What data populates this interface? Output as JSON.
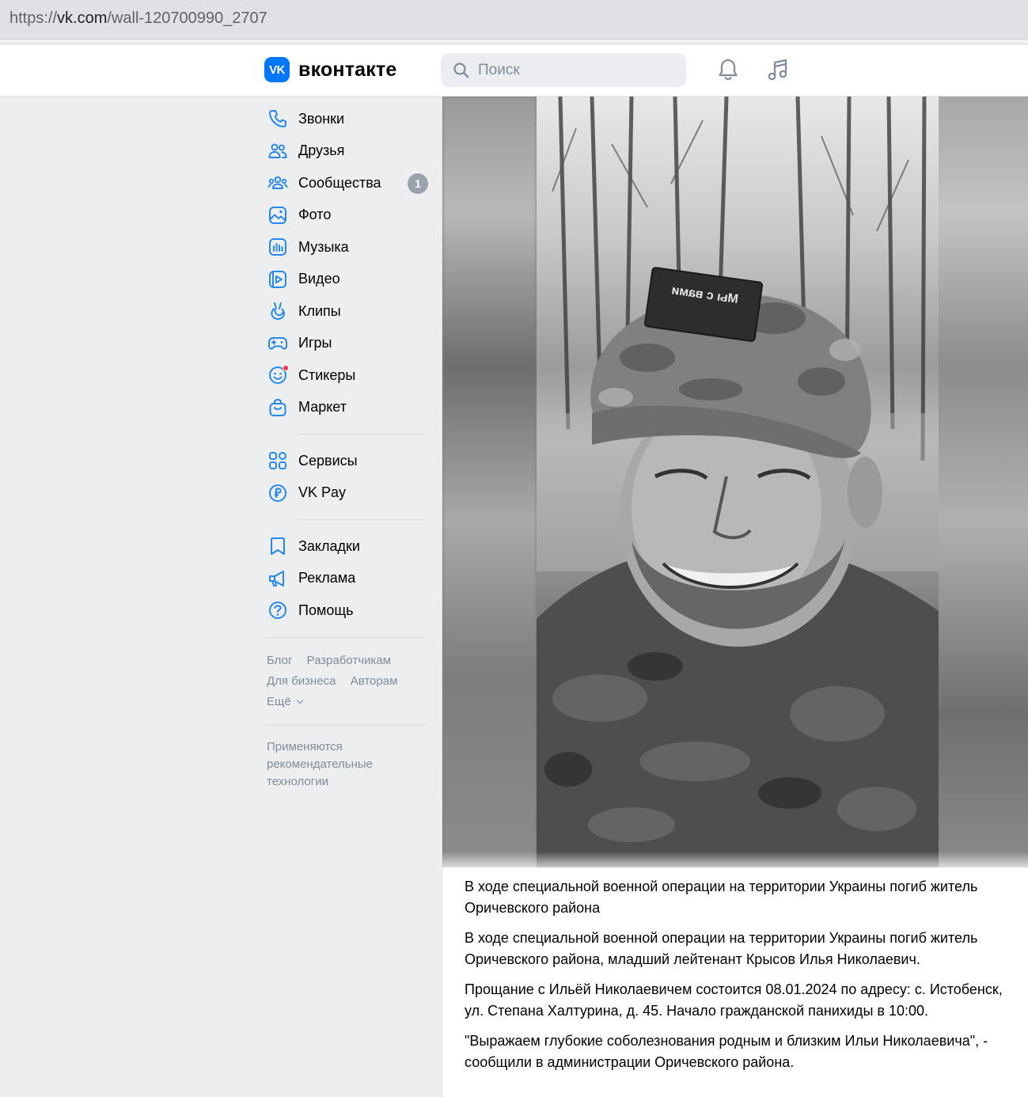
{
  "browser": {
    "url_prefix": "https://",
    "url_domain": "vk.com",
    "url_path": "/wall-120700990_2707"
  },
  "header": {
    "logo_badge": "VK",
    "logo_text": "вконтакте",
    "search_placeholder": "Поиск",
    "icons": [
      "bell-icon",
      "music-note-icon"
    ]
  },
  "sidebar": {
    "items": [
      {
        "label": "Звонки",
        "icon": "phone-icon"
      },
      {
        "label": "Друзья",
        "icon": "friends-icon"
      },
      {
        "label": "Сообщества",
        "icon": "communities-icon",
        "count": "1"
      },
      {
        "label": "Фото",
        "icon": "photo-icon"
      },
      {
        "label": "Музыка",
        "icon": "music-icon"
      },
      {
        "label": "Видео",
        "icon": "video-icon"
      },
      {
        "label": "Клипы",
        "icon": "clips-icon"
      },
      {
        "label": "Игры",
        "icon": "gamepad-icon"
      },
      {
        "label": "Стикеры",
        "icon": "smile-icon"
      },
      {
        "label": "Маркет",
        "icon": "market-bag-icon"
      }
    ],
    "items2": [
      {
        "label": "Сервисы",
        "icon": "services-grid-icon"
      },
      {
        "label": "VK Pay",
        "icon": "ruble-icon"
      }
    ],
    "items3": [
      {
        "label": "Закладки",
        "icon": "bookmark-icon"
      },
      {
        "label": "Реклама",
        "icon": "megaphone-icon"
      },
      {
        "label": "Помощь",
        "icon": "help-icon"
      }
    ],
    "footer": {
      "blog": "Блог",
      "developers": "Разработчикам",
      "business": "Для бизнеса",
      "authors": "Авторам",
      "more": "Ещё"
    },
    "reco_line1": "Применяются",
    "reco_line2": "рекомендательные",
    "reco_line3": "технологии"
  },
  "post": {
    "photo_alt": "Портрет мужчины в камуфляжной кепке (чёрно-белое фото)",
    "cap_patch": "Мы с вами",
    "paragraphs": [
      "В ходе специальной военной операции на территории Украины погиб житель Оричевского района",
      "В ходе специальной военной операции на территории Украины погиб житель Оричевского района, младший лейтенант Крысов Илья Николаевич.",
      "Прощание с Ильёй Николаевичем состоится 08.01.2024 по адресу: с. Истобенск, ул. Степана Халтурина, д. 45. Начало гражданской панихиды в 10:00.",
      "\"Выражаем глубокие соболезнования родным и близким Ильи Николаевича\", - сообщили в администрации Оричевского района."
    ]
  },
  "colors": {
    "accent": "#0077ff",
    "icon_blue": "#2688eb",
    "muted": "#818c99",
    "bg": "#edeef0"
  }
}
